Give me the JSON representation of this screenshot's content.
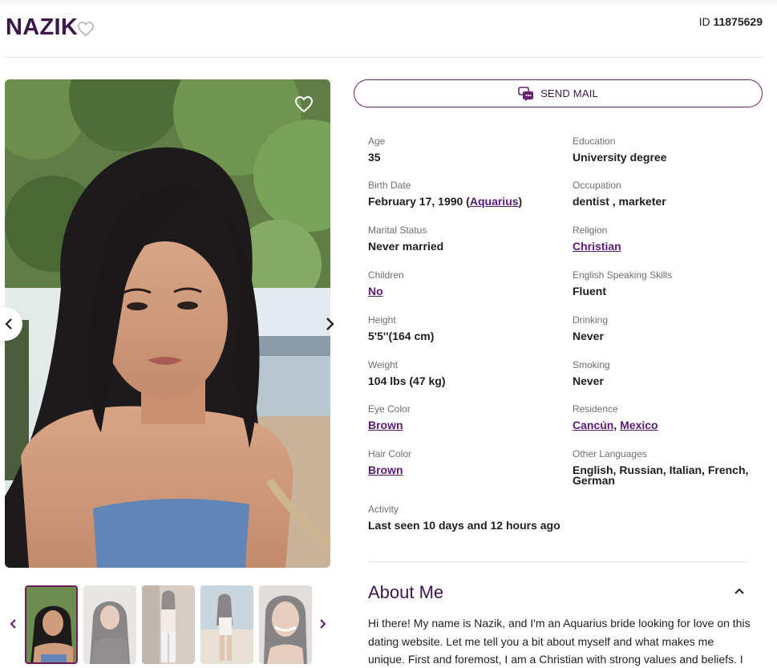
{
  "profile": {
    "name": "NAZIK",
    "id_label": "ID",
    "id_value": "11875629"
  },
  "actions": {
    "send_mail": "SEND MAIL"
  },
  "details": {
    "age": {
      "label": "Age",
      "value": "35"
    },
    "birth_date": {
      "label": "Birth Date",
      "value": "February 17, 1990 (",
      "sign": "Aquarius",
      "suffix": ")"
    },
    "marital_status": {
      "label": "Marital Status",
      "value": "Never married"
    },
    "children": {
      "label": "Children",
      "value": "No"
    },
    "height": {
      "label": "Height",
      "value": "5'5''(164 cm)"
    },
    "weight": {
      "label": "Weight",
      "value": "104 lbs (47 kg)"
    },
    "eye_color": {
      "label": "Eye Color",
      "value": "Brown"
    },
    "hair_color": {
      "label": "Hair Color",
      "value": "Brown"
    },
    "activity": {
      "label": "Activity",
      "value": "Last seen 10 days and 12 hours ago"
    },
    "education": {
      "label": "Education",
      "value": "University degree"
    },
    "occupation": {
      "label": "Occupation",
      "value": "dentist , marketer"
    },
    "religion": {
      "label": "Religion",
      "value": "Christian"
    },
    "english": {
      "label": "English Speaking Skills",
      "value": "Fluent"
    },
    "drinking": {
      "label": "Drinking",
      "value": "Never"
    },
    "smoking": {
      "label": "Smoking",
      "value": "Never"
    },
    "residence": {
      "label": "Residence",
      "city": "Cancún",
      "sep": ", ",
      "country": "Mexico"
    },
    "other_languages": {
      "label": "Other Languages",
      "value": "English, Russian, Italian, French, German"
    }
  },
  "about": {
    "title": "About Me",
    "text": "Hi there! My name is Nazik, and I'm an Aquarius bride looking for love on this dating website. Let me tell you a bit about myself and what makes me unique. First and foremost, I am a Christian with strong values and beliefs. I"
  },
  "colors": {
    "brand": "#3b1747",
    "link": "#5a1a74",
    "accent_border": "#6a2372"
  },
  "icons": {
    "favorite": "heart-outline-icon",
    "mail": "chat-bubble-icon",
    "prev": "chevron-left-icon",
    "next": "chevron-right-icon",
    "collapse": "chevron-up-icon"
  }
}
